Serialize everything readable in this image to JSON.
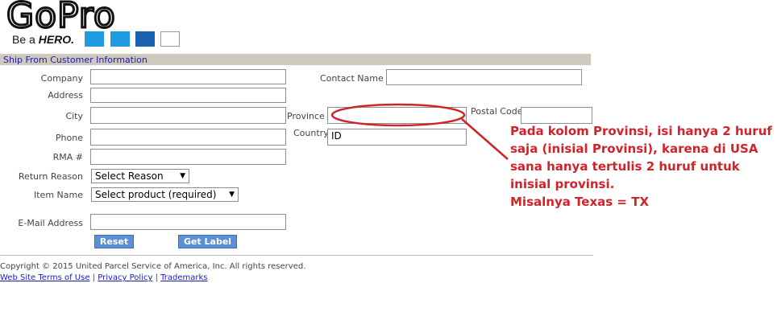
{
  "brand": {
    "logo_text": "GoPro",
    "tagline_prefix": "Be a",
    "tagline_emphasis": "HERO.",
    "squares": [
      "#1e9be1",
      "#1e9be1",
      "#1a63b0",
      "#ffffff"
    ]
  },
  "section": {
    "title": "Ship From Customer Information"
  },
  "form": {
    "company_label": "Company",
    "address_label": "Address",
    "city_label": "City",
    "phone_label": "Phone",
    "rma_label": "RMA #",
    "return_reason_label": "Return Reason",
    "item_name_label": "Item Name",
    "email_label": "E-Mail Address",
    "contact_name_label": "Contact Name",
    "province_label": "Province",
    "postal_code_label": "Postal Code",
    "country_label": "Country",
    "country_value": "ID",
    "return_reason_selected": "Select Reason",
    "item_name_selected": "Select product (required)",
    "reset_label": "Reset",
    "get_label_label": "Get Label"
  },
  "footer": {
    "copyright": "Copyright © 2015 United Parcel Service of America, Inc. All rights reserved.",
    "links": [
      "Web Site Terms of Use",
      "Privacy Policy",
      "Trademarks"
    ],
    "separator": "|"
  },
  "annotation": {
    "color": "#d0232a",
    "lines": [
      "Pada kolom Provinsi, isi hanya 2 huruf",
      "saja (inisial Provinsi), karena di USA",
      "sana hanya tertulis 2 huruf untuk",
      "inisial provinsi.",
      "Misalnya Texas = TX"
    ]
  }
}
